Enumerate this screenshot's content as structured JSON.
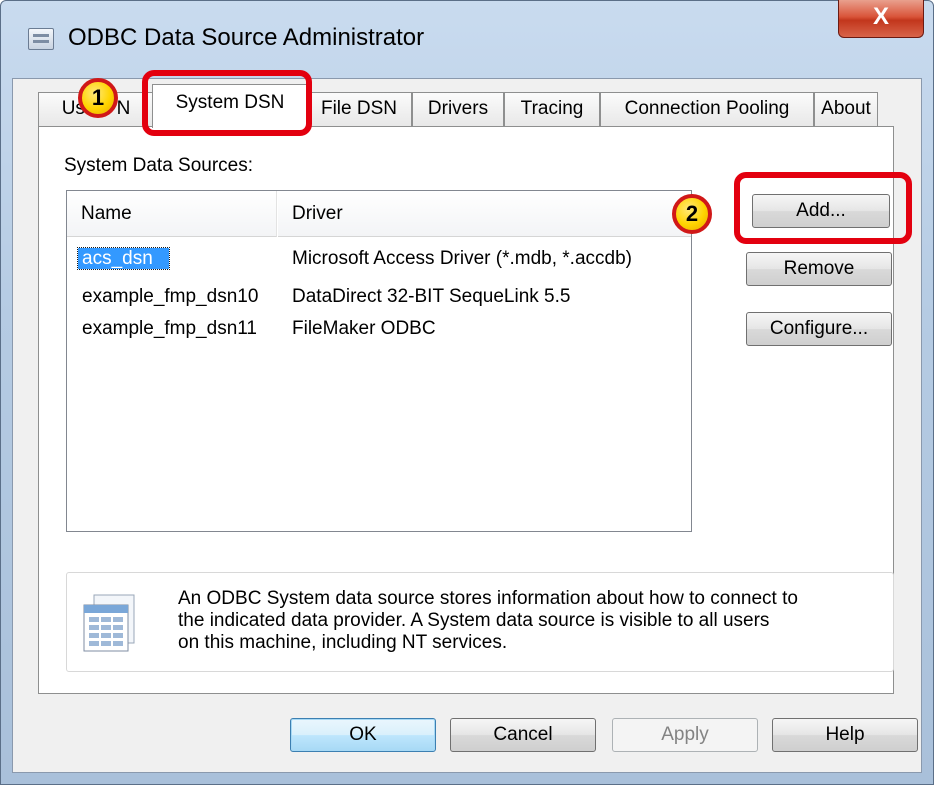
{
  "window": {
    "title": "ODBC Data Source Administrator",
    "close_label": "X"
  },
  "tabs": [
    {
      "label": "User DSN",
      "visible_label": "Us      N",
      "active": false
    },
    {
      "label": "System DSN",
      "active": true
    },
    {
      "label": "File DSN",
      "active": false
    },
    {
      "label": "Drivers",
      "active": false
    },
    {
      "label": "Tracing",
      "active": false
    },
    {
      "label": "Connection Pooling",
      "active": false
    },
    {
      "label": "About",
      "active": false
    }
  ],
  "system_sources": {
    "label": "System Data Sources:",
    "columns": [
      "Name",
      "Driver"
    ],
    "rows": [
      {
        "name": "acs_dsn",
        "driver": "Microsoft Access Driver (*.mdb, *.accdb)",
        "selected": true
      },
      {
        "name": "example_fmp_dsn10",
        "driver": "DataDirect 32-BIT SequeLink 5.5",
        "selected": false
      },
      {
        "name": "example_fmp_dsn11",
        "driver": "FileMaker ODBC",
        "selected": false
      }
    ]
  },
  "side_buttons": {
    "add": "Add...",
    "remove": "Remove",
    "configure": "Configure..."
  },
  "info": {
    "line1": "An ODBC System data source stores information about how to connect to",
    "line2": "the indicated data provider.  A System data source is visible to all users",
    "line3": "on this machine, including NT services."
  },
  "footer_buttons": {
    "ok": "OK",
    "cancel": "Cancel",
    "apply": "Apply",
    "help": "Help"
  },
  "annotations": [
    {
      "number": "1",
      "color": "#e3000f"
    },
    {
      "number": "2",
      "color": "#e3000f"
    }
  ]
}
